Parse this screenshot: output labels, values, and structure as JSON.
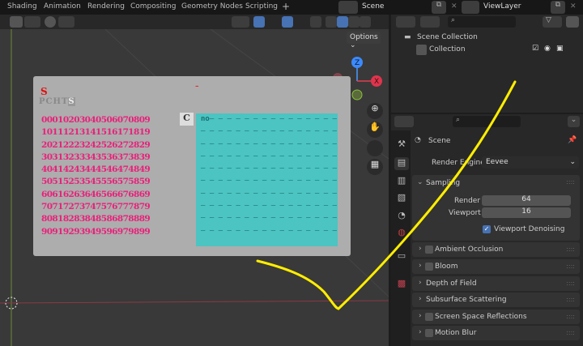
{
  "topbar": {
    "tabs": [
      "Shading",
      "Animation",
      "Rendering",
      "Compositing",
      "Geometry Nodes",
      "Scripting"
    ],
    "add": "+",
    "scene": "Scene",
    "view_layer": "ViewLayer"
  },
  "viewport": {
    "options": "Options",
    "gizmo": {
      "z": "Z",
      "x": "X"
    }
  },
  "overlay": {
    "title": "S",
    "dash": "–",
    "tabs": [
      "P",
      "C",
      "H",
      "T",
      "S"
    ],
    "c_button": "C",
    "rows": [
      "00010203040506070809",
      "10111213141516171819",
      "20212223242526272829",
      "30313233343536373839",
      "40414243444546474849",
      "50515253545556575859",
      "60616263646566676869",
      "70717273747576777879",
      "80818283848586878889",
      "90919293949596979899"
    ],
    "panel_first": "no",
    "panel_dashes": "– – – – – – – – – – – – – – – – – – – – – –"
  },
  "outliner": {
    "scene_collection": "Scene Collection",
    "collection": "Collection"
  },
  "properties": {
    "context": "Scene",
    "render_engine_label": "Render Engine",
    "render_engine": "Eevee",
    "sampling": {
      "title": "Sampling",
      "render_label": "Render",
      "render": "64",
      "viewport_label": "Viewport",
      "viewport": "16",
      "denoise": "Viewport Denoising"
    },
    "sections": [
      "Ambient Occlusion",
      "Bloom",
      "Depth of Field",
      "Subsurface Scattering",
      "Screen Space Reflections",
      "Motion Blur"
    ]
  },
  "colors": {
    "accent": "#4772b3",
    "annotation": "#ffee00",
    "grid_text": "#e8217a",
    "panel": "#4bc4c2"
  }
}
